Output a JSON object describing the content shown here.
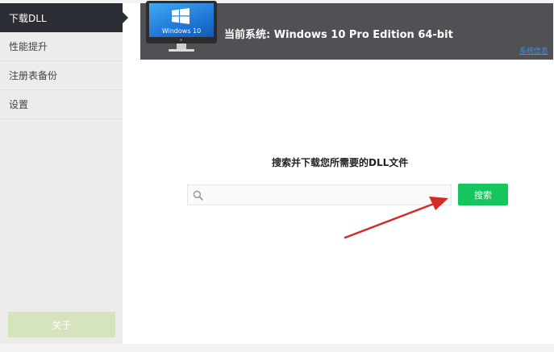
{
  "sidebar": {
    "items": [
      {
        "label": "下载DLL",
        "active": true
      },
      {
        "label": "性能提升",
        "active": false
      },
      {
        "label": "注册表备份",
        "active": false
      },
      {
        "label": "设置",
        "active": false
      }
    ],
    "about_label": "关于"
  },
  "header": {
    "monitor_label": "Windows 10",
    "system_text": "当前系统: Windows 10 Pro Edition  64-bit",
    "link_text": "系统信息"
  },
  "main": {
    "prompt": "搜索并下载您所需要的DLL文件",
    "search": {
      "value": "",
      "placeholder": ""
    },
    "search_button": "搜索"
  },
  "icons": [
    "windows-logo-icon",
    "search-icon",
    "red-arrow-icon"
  ],
  "colors": {
    "sidebar_active": "#2b2e35",
    "header_bg": "#505155",
    "search_button": "#15c55e",
    "about_button": "#d6e4bd",
    "annotation_arrow": "#d42a2a"
  }
}
